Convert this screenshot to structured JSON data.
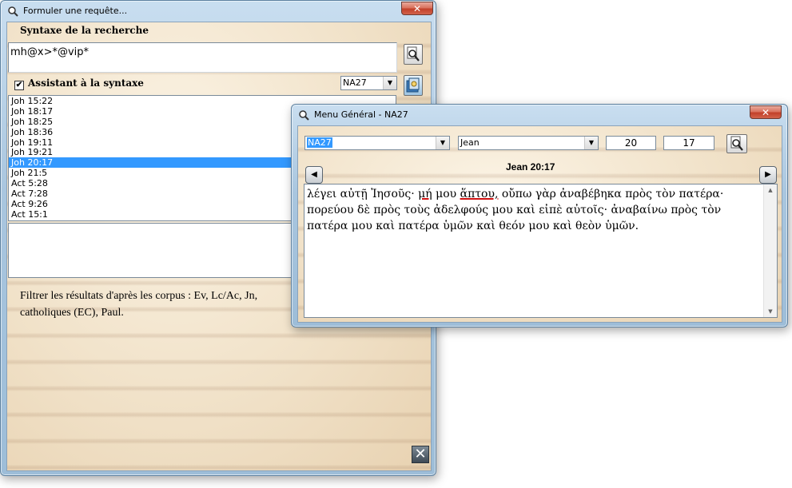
{
  "query_window": {
    "title": "Formuler une requête...",
    "section_label": "Syntaxe de la recherche",
    "syntax_value": "mh@x>*@vip*",
    "assistant_label": "Assistant à la syntaxe",
    "assistant_checked": true,
    "assistant_check_glyph": "✔",
    "corpus_select": "NA27",
    "results": [
      "Joh 15:22",
      "Joh 18:17",
      "Joh 18:25",
      "Joh 18:36",
      "Joh 19:11",
      "Joh 19:21",
      "Joh 20:17",
      "Joh 21:5",
      "Act 5:28",
      "Act 7:28",
      "Act 9:26",
      "Act 15:1"
    ],
    "selected_result": "Joh 20:17",
    "help_text": "Filtrer les résultats d'après les corpus : Ev, Lc/Ac, Jn, catholiques (EC), Paul.",
    "close_glyph": "✕"
  },
  "menu_window": {
    "title": "Menu Général - NA27",
    "close_glyph": "✕",
    "edition_select": "NA27",
    "book_select": "Jean",
    "chapter": "20",
    "verse": "17",
    "reference_title": "Jean 20:17",
    "prev_glyph": "◀",
    "next_glyph": "▶",
    "scroll_up_glyph": "▲",
    "scroll_down_glyph": "▼",
    "text_segments": {
      "s1": "λέγει αὐτῇ Ἰησοῦς· ",
      "h1": "μή",
      "s2": " μου ",
      "h2": "ἅπτου,",
      "s3": " οὔπω γὰρ ἀναβέβηκα πρὸς τὸν πατέρα· πορεύου δὲ πρὸς τοὺς ἀδελφούς μου καὶ εἰπὲ αὐτοῖς· ἀναβαίνω πρὸς τὸν πατέρα μου καὶ πατέρα ὑμῶν καὶ θεόν μου καὶ θεὸν ὑμῶν."
    }
  }
}
